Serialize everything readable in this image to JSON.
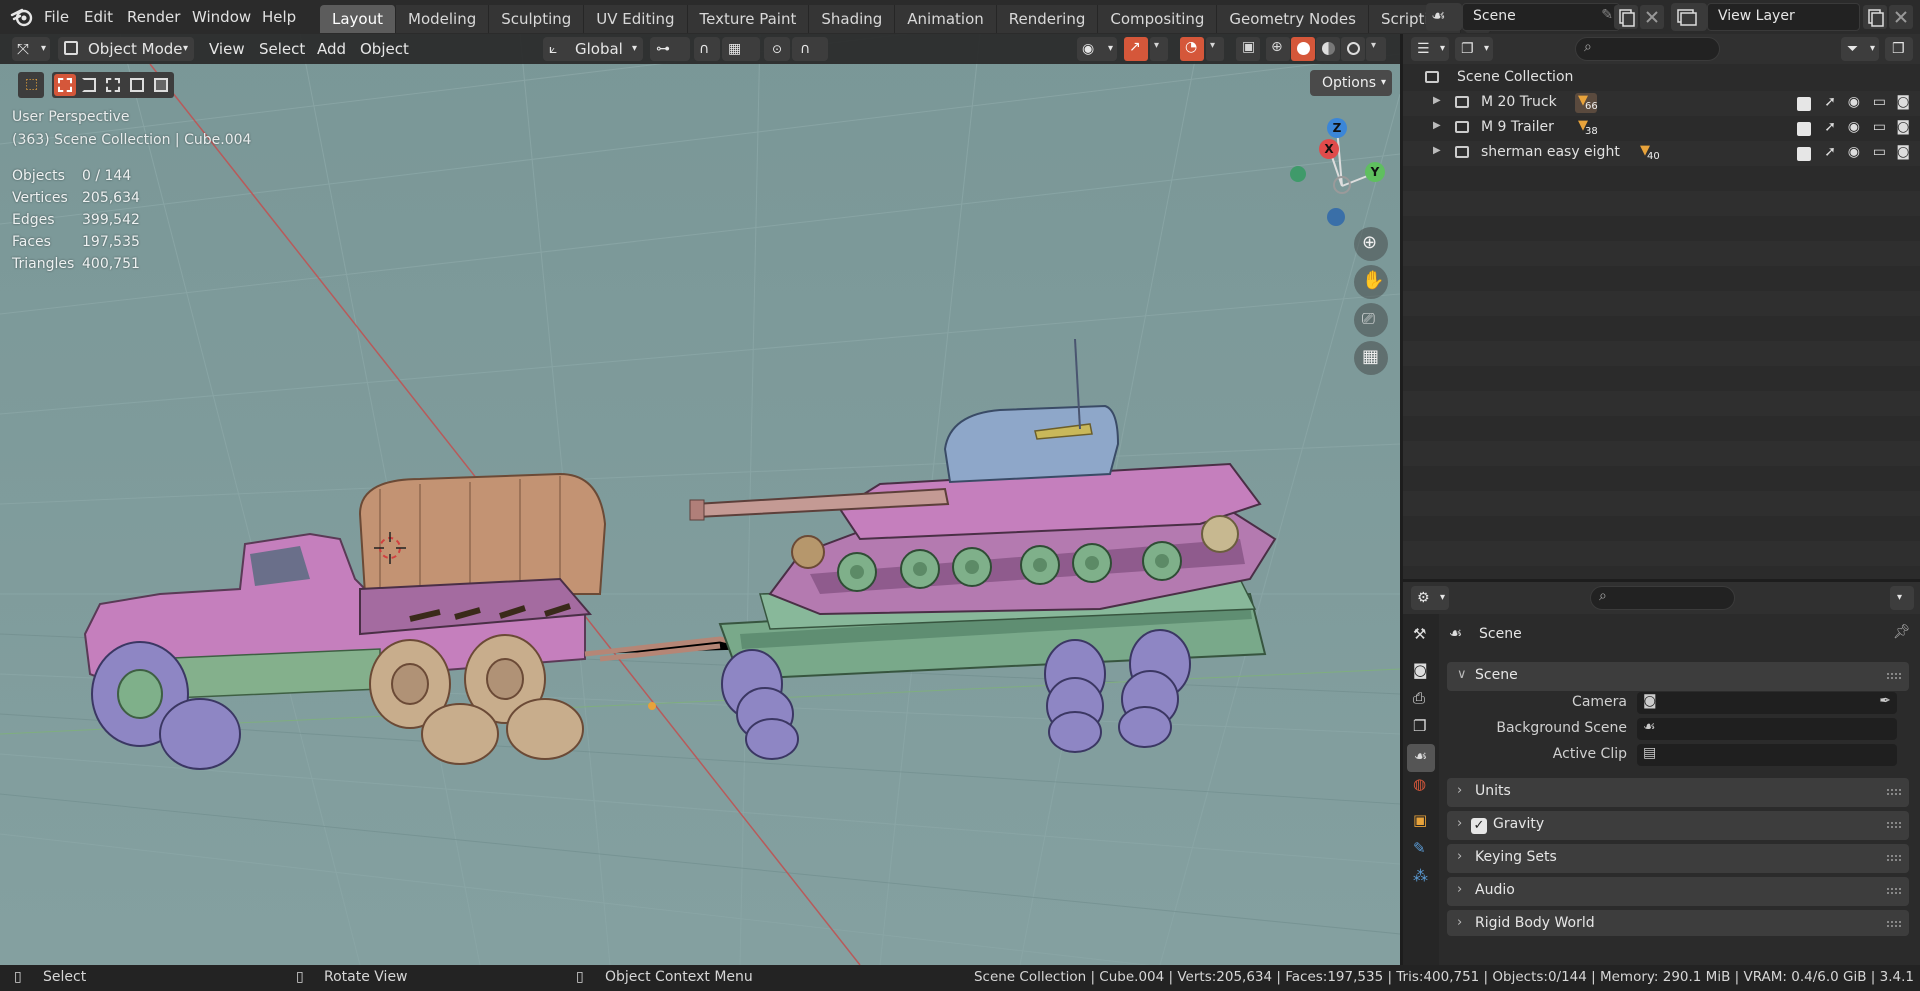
{
  "topbar": {
    "menus": [
      "File",
      "Edit",
      "Render",
      "Window",
      "Help"
    ],
    "workspaces": [
      "Layout",
      "Modeling",
      "Sculpting",
      "UV Editing",
      "Texture Paint",
      "Shading",
      "Animation",
      "Rendering",
      "Compositing",
      "Geometry Nodes",
      "Scripting"
    ],
    "active_workspace": "Layout",
    "add_tab": "+",
    "scene_name": "Scene",
    "view_layer_name": "View Layer"
  },
  "viewport": {
    "mode": "Object Mode",
    "menus": [
      "View",
      "Select",
      "Add",
      "Object"
    ],
    "orientation": "Global",
    "options_label": "Options",
    "perspective": "User Perspective",
    "collection_info": "(363) Scene Collection | Cube.004",
    "stats": [
      {
        "label": "Objects",
        "value": "0 / 144"
      },
      {
        "label": "Vertices",
        "value": "205,634"
      },
      {
        "label": "Edges",
        "value": "399,542"
      },
      {
        "label": "Faces",
        "value": "197,535"
      },
      {
        "label": "Triangles",
        "value": "400,751"
      }
    ],
    "gizmo": {
      "z": "Z",
      "x": "X",
      "y": "Y"
    },
    "background_color": "#7c9898"
  },
  "outliner": {
    "root": "Scene Collection",
    "collections": [
      {
        "name": "M 20 Truck",
        "count": "66"
      },
      {
        "name": "M 9 Trailer",
        "count": "38"
      },
      {
        "name": "sherman easy eight",
        "count": "40"
      }
    ]
  },
  "properties": {
    "header_title": "Scene",
    "panels": {
      "scene": "Scene",
      "units": "Units",
      "gravity": "Gravity",
      "keying_sets": "Keying Sets",
      "audio": "Audio",
      "rigid_body_world": "Rigid Body World"
    },
    "fields": {
      "camera": "Camera",
      "background_scene": "Background Scene",
      "active_clip": "Active Clip"
    },
    "gravity_enabled": true
  },
  "statusbar": {
    "select": "Select",
    "rotate": "Rotate View",
    "context": "Object Context Menu",
    "info": "Scene Collection | Cube.004 | Verts:205,634 | Faces:197,535 | Tris:400,751 | Objects:0/144 | Memory: 290.1 MiB | VRAM: 0.4/6.0 GiB | 3.4.1"
  }
}
